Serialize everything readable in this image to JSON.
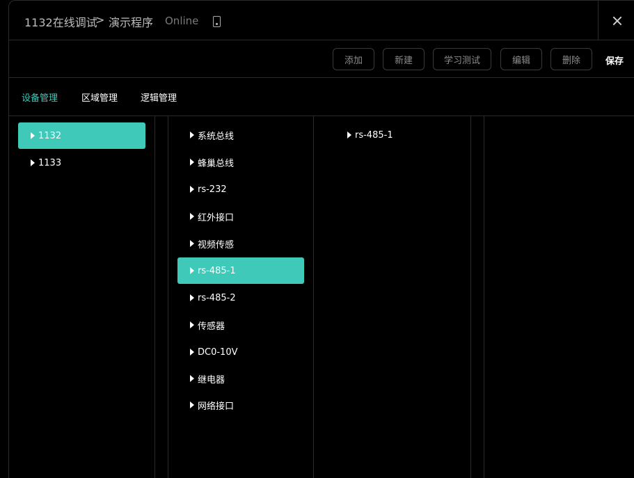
{
  "header": {
    "breadcrumb_root": "1132在线调试",
    "separator": ">",
    "breadcrumb_current": "演示程序",
    "status": "Online",
    "status_icon": "phone-icon",
    "close_icon": "close-icon"
  },
  "toolbar": {
    "add_label": "添加",
    "new_label": "新建",
    "learn_test_label": "学习测试",
    "edit_label": "编辑",
    "delete_label": "删除",
    "save_label": "保存"
  },
  "tabs": [
    {
      "label": "设备管理",
      "active": true
    },
    {
      "label": "区域管理",
      "active": false
    },
    {
      "label": "逻辑管理",
      "active": false
    }
  ],
  "devices": [
    {
      "label": "1132",
      "selected": true
    },
    {
      "label": "1133",
      "selected": false
    }
  ],
  "interfaces": [
    {
      "label": "系统总线",
      "selected": false
    },
    {
      "label": "蜂巢总线",
      "selected": false
    },
    {
      "label": "rs-232",
      "selected": false
    },
    {
      "label": "红外接口",
      "selected": false
    },
    {
      "label": "视频传感",
      "selected": false
    },
    {
      "label": "rs-485-1",
      "selected": true
    },
    {
      "label": "rs-485-2",
      "selected": false
    },
    {
      "label": "传感器",
      "selected": false
    },
    {
      "label": "DC0-10V",
      "selected": false
    },
    {
      "label": "继电器",
      "selected": false
    },
    {
      "label": "网络接口",
      "selected": false
    }
  ],
  "sub_items": [
    {
      "label": "rs-485-1",
      "selected": false
    }
  ],
  "colors": {
    "accent": "#3ec9b9",
    "background": "#000000",
    "border": "#2a2a2a"
  }
}
